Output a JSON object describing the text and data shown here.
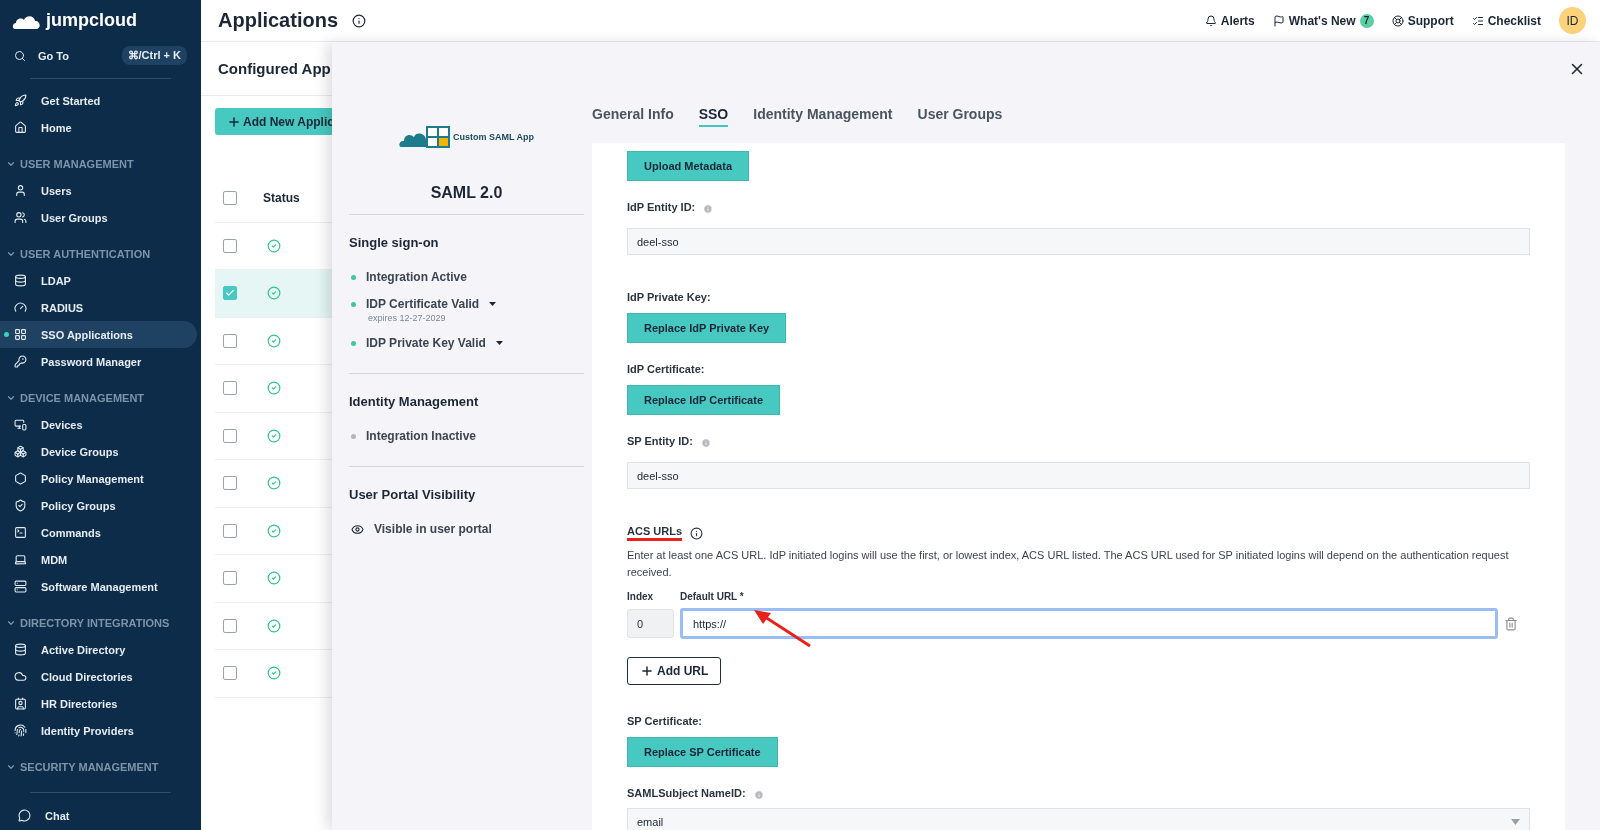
{
  "sidebar": {
    "logo": "jumpcloud",
    "goto": {
      "label": "Go To",
      "shortcut": "⌘/Ctrl + K"
    },
    "groups": [
      {
        "items": [
          {
            "label": "Get Started",
            "selected": false
          },
          {
            "label": "Home",
            "selected": false
          }
        ]
      },
      {
        "title": "USER MANAGEMENT",
        "expanded": true,
        "items": [
          {
            "label": "Users",
            "selected": false
          },
          {
            "label": "User Groups",
            "selected": false
          }
        ]
      },
      {
        "title": "USER AUTHENTICATION",
        "expanded": true,
        "items": [
          {
            "label": "LDAP",
            "selected": false
          },
          {
            "label": "RADIUS",
            "selected": false
          },
          {
            "label": "SSO Applications",
            "selected": true
          },
          {
            "label": "Password Manager",
            "selected": false
          }
        ]
      },
      {
        "title": "DEVICE MANAGEMENT",
        "expanded": true,
        "items": [
          {
            "label": "Devices",
            "selected": false
          },
          {
            "label": "Device Groups",
            "selected": false
          },
          {
            "label": "Policy Management",
            "selected": false
          },
          {
            "label": "Policy Groups",
            "selected": false
          },
          {
            "label": "Commands",
            "selected": false
          },
          {
            "label": "MDM",
            "selected": false
          },
          {
            "label": "Software Management",
            "selected": false
          }
        ]
      },
      {
        "title": "DIRECTORY INTEGRATIONS",
        "expanded": true,
        "items": [
          {
            "label": "Active Directory",
            "selected": false
          },
          {
            "label": "Cloud Directories",
            "selected": false
          },
          {
            "label": "HR Directories",
            "selected": false
          },
          {
            "label": "Identity Providers",
            "selected": false
          }
        ]
      },
      {
        "title": "SECURITY MANAGEMENT",
        "expanded": true
      }
    ],
    "chat": "Chat"
  },
  "header": {
    "title": "Applications",
    "links": [
      {
        "label": "Alerts"
      },
      {
        "label": "What's New",
        "badge": "7"
      },
      {
        "label": "Support"
      },
      {
        "label": "Checklist"
      }
    ],
    "avatar": "ID"
  },
  "page": {
    "subtitle": "Configured App",
    "add_button": "Add New Applic",
    "column": "Status",
    "header_checked": false,
    "rows": [
      {
        "checked": false
      },
      {
        "checked": true
      },
      {
        "checked": false
      },
      {
        "checked": false
      },
      {
        "checked": false
      },
      {
        "checked": false
      },
      {
        "checked": false
      },
      {
        "checked": false
      },
      {
        "checked": false
      },
      {
        "checked": false
      }
    ]
  },
  "drawer": {
    "app_label": "Custom SAML App",
    "protocol": "SAML 2.0",
    "sections": [
      {
        "title": "Single sign-on",
        "items": [
          {
            "label": "Integration Active",
            "active": true
          },
          {
            "label": "IDP Certificate Valid",
            "active": true,
            "dropdown": true,
            "note": "expires 12-27-2029"
          },
          {
            "label": "IDP Private Key Valid",
            "active": true,
            "dropdown": true
          }
        ]
      },
      {
        "title": "Identity Management",
        "items": [
          {
            "label": "Integration Inactive",
            "active": false
          }
        ]
      },
      {
        "title": "User Portal Visibility",
        "visibility": "Visible in user portal"
      }
    ],
    "tabs": [
      {
        "label": "General Info",
        "selected": false
      },
      {
        "label": "SSO",
        "selected": true
      },
      {
        "label": "Identity Management",
        "selected": false
      },
      {
        "label": "User Groups",
        "selected": false
      }
    ],
    "fields": [
      {
        "kind": "button",
        "button": "Upload Metadata"
      },
      {
        "kind": "text",
        "label": "IdP Entity ID:",
        "info": true,
        "value": "deel-sso"
      },
      {
        "kind": "button",
        "label": "IdP Private Key:",
        "button": "Replace IdP Private Key"
      },
      {
        "kind": "button",
        "label": "IdP Certificate:",
        "button": "Replace IdP Certificate"
      },
      {
        "kind": "text",
        "label": "SP Entity ID:",
        "info": true,
        "value": "deel-sso"
      },
      {
        "kind": "acs",
        "label": "ACS URLs",
        "highlighted": true,
        "description": "Enter at least one ACS URL. IdP initiated logins will use the first, or lowest index, ACS URL listed. The ACS URL used for SP initiated logins will depend on the authentication request received.",
        "index_label": "Index",
        "url_label": "Default URL *",
        "index": "0",
        "url": "https://",
        "focused": true,
        "pointer_arrow": true,
        "add_button": "Add URL"
      },
      {
        "kind": "button",
        "label": "SP Certificate:",
        "button": "Replace SP Certificate"
      },
      {
        "kind": "select",
        "label": "SAMLSubject NameID:",
        "info": true,
        "value": "email"
      }
    ]
  }
}
